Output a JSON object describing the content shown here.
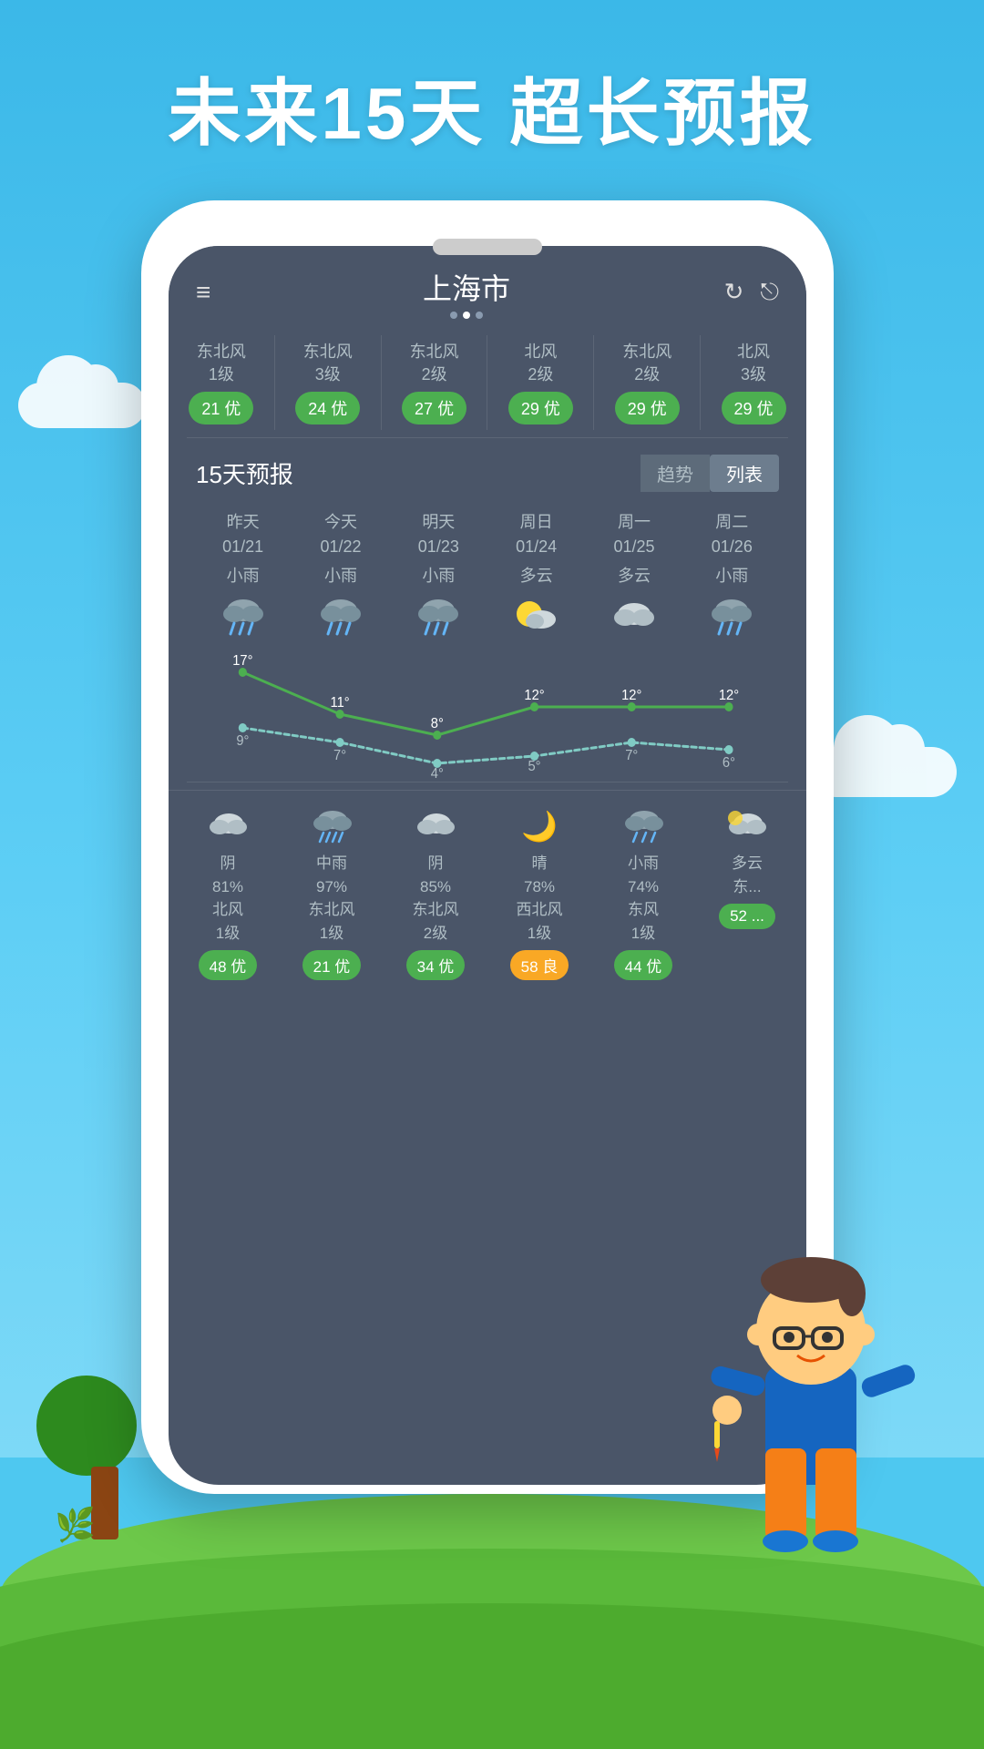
{
  "title": "未来15天  超长预报",
  "sky": {
    "clouds": [
      "left",
      "right"
    ]
  },
  "phone": {
    "speaker": true,
    "header": {
      "city": "上海市",
      "dots": [
        false,
        true,
        false
      ],
      "menu_icon": "≡",
      "crown_icon": "♛",
      "refresh_icon": "↻",
      "share_icon": "⎋"
    },
    "wind_aqi_row": [
      {
        "wind": "东北风\n1级",
        "aqi": "21 优",
        "aqi_type": "good"
      },
      {
        "wind": "东北风\n3级",
        "aqi": "24 优",
        "aqi_type": "good"
      },
      {
        "wind": "东北风\n2级",
        "aqi": "27 优",
        "aqi_type": "good"
      },
      {
        "wind": "北风\n2级",
        "aqi": "29 优",
        "aqi_type": "good"
      },
      {
        "wind": "东北风\n2级",
        "aqi": "29 优",
        "aqi_type": "good"
      },
      {
        "wind": "北风\n3级",
        "aqi": "29 优",
        "aqi_type": "good"
      }
    ],
    "forecast": {
      "title": "15天预报",
      "tabs": [
        "趋势",
        "列表"
      ],
      "active_tab": "趋势",
      "days": [
        {
          "label": "昨天\n01/21",
          "condition": "小雨",
          "icon": "rain",
          "high": "17°",
          "low": "9°"
        },
        {
          "label": "今天\n01/22",
          "condition": "小雨",
          "icon": "rain",
          "high": "11°",
          "low": "7°"
        },
        {
          "label": "明天\n01/23",
          "condition": "小雨",
          "icon": "rain",
          "high": "8°",
          "low": "4°"
        },
        {
          "label": "周日\n01/24",
          "condition": "多云",
          "icon": "partly-cloudy",
          "high": "12°",
          "low": "5°"
        },
        {
          "label": "周一\n01/25",
          "condition": "多云",
          "icon": "cloudy",
          "high": "12°",
          "low": "7°"
        },
        {
          "label": "周二\n01/26",
          "condition": "小雨",
          "icon": "rain",
          "high": "12°",
          "low": "6°"
        }
      ],
      "chart": {
        "high_points": [
          17,
          11,
          8,
          12,
          12,
          12
        ],
        "low_points": [
          9,
          7,
          4,
          5,
          7,
          6
        ]
      }
    },
    "bottom_detail": [
      {
        "icon": "cloud",
        "condition": "阴\n81%\n北风\n1级",
        "aqi": "48 优",
        "aqi_type": "good"
      },
      {
        "icon": "heavy-rain",
        "condition": "中雨\n97%\n东北风\n1级",
        "aqi": "21 优",
        "aqi_type": "good"
      },
      {
        "icon": "cloud",
        "condition": "阴\n85%\n东北风\n2级",
        "aqi": "34 优",
        "aqi_type": "good"
      },
      {
        "icon": "moon",
        "condition": "晴\n78%\n西北风\n1级",
        "aqi": "58 良",
        "aqi_type": "liang"
      },
      {
        "icon": "rain",
        "condition": "小雨\n74%\n东风\n1级",
        "aqi": "44 优",
        "aqi_type": "good"
      },
      {
        "icon": "cloudy",
        "condition": "多云\n东...",
        "aqi": "52 ...",
        "aqi_type": "good"
      }
    ]
  }
}
